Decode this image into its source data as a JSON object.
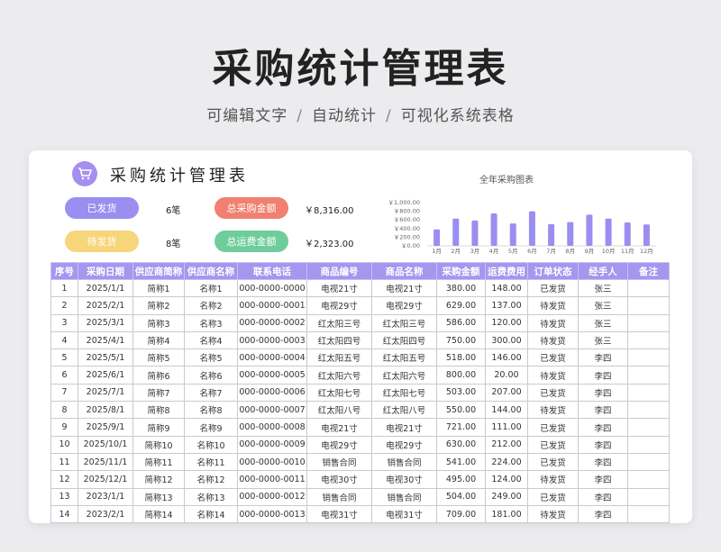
{
  "header": {
    "title": "采购统计管理表",
    "subtitle_parts": [
      "可编辑文字",
      "自动统计",
      "可视化系统表格"
    ],
    "separator": "/"
  },
  "card": {
    "title": "采购统计管理表",
    "logo_icon": "shopping-cart-icon",
    "stats": {
      "shipped_label": "已发货",
      "shipped_count": "6笔",
      "pending_label": "待发货",
      "pending_count": "8笔",
      "total_amount_label": "总采购金额",
      "total_amount": "￥8,316.00",
      "total_freight_label": "总运费金额",
      "total_freight": "￥2,323.00"
    },
    "colors": {
      "shipped": "#9a8ef0",
      "pending": "#f7d57a",
      "amount": "#f08070",
      "freight": "#6fcd9c",
      "table_header": "#a596ee",
      "bar": "#9a8ef0"
    }
  },
  "chart_data": {
    "type": "bar",
    "title": "全年采购图表",
    "categories": [
      "1月",
      "2月",
      "3月",
      "4月",
      "5月",
      "6月",
      "7月",
      "8月",
      "9月",
      "10月",
      "11月",
      "12月"
    ],
    "values": [
      380,
      629,
      586,
      750,
      518,
      800,
      503,
      550,
      721,
      630,
      541,
      495
    ],
    "ylim": [
      0,
      1000
    ],
    "yticks": [
      "￥1,000.00",
      "￥800.00",
      "￥600.00",
      "￥400.00",
      "￥200.00",
      "￥0.00"
    ],
    "ytick_values": [
      1000,
      800,
      600,
      400,
      200,
      0
    ],
    "grid": false,
    "legend": "none"
  },
  "table": {
    "columns": [
      "序号",
      "采购日期",
      "供应商简称",
      "供应商名称",
      "联系电话",
      "商品编号",
      "商品名称",
      "采购金额",
      "运费费用",
      "订单状态",
      "经手人",
      "备注"
    ],
    "rows": [
      [
        "1",
        "2025/1/1",
        "简称1",
        "名称1",
        "000-0000-0000",
        "电视21寸",
        "电视21寸",
        "380.00",
        "148.00",
        "已发货",
        "张三",
        ""
      ],
      [
        "2",
        "2025/2/1",
        "简称2",
        "名称2",
        "000-0000-0001",
        "电视29寸",
        "电视29寸",
        "629.00",
        "137.00",
        "待发货",
        "张三",
        ""
      ],
      [
        "3",
        "2025/3/1",
        "简称3",
        "名称3",
        "000-0000-0002",
        "红太阳三号",
        "红太阳三号",
        "586.00",
        "120.00",
        "待发货",
        "张三",
        ""
      ],
      [
        "4",
        "2025/4/1",
        "简称4",
        "名称4",
        "000-0000-0003",
        "红太阳四号",
        "红太阳四号",
        "750.00",
        "300.00",
        "待发货",
        "张三",
        ""
      ],
      [
        "5",
        "2025/5/1",
        "简称5",
        "名称5",
        "000-0000-0004",
        "红太阳五号",
        "红太阳五号",
        "518.00",
        "146.00",
        "已发货",
        "李四",
        ""
      ],
      [
        "6",
        "2025/6/1",
        "简称6",
        "名称6",
        "000-0000-0005",
        "红太阳六号",
        "红太阳六号",
        "800.00",
        "20.00",
        "待发货",
        "李四",
        ""
      ],
      [
        "7",
        "2025/7/1",
        "简称7",
        "名称7",
        "000-0000-0006",
        "红太阳七号",
        "红太阳七号",
        "503.00",
        "207.00",
        "已发货",
        "李四",
        ""
      ],
      [
        "8",
        "2025/8/1",
        "简称8",
        "名称8",
        "000-0000-0007",
        "红太阳八号",
        "红太阳八号",
        "550.00",
        "144.00",
        "待发货",
        "李四",
        ""
      ],
      [
        "9",
        "2025/9/1",
        "简称9",
        "名称9",
        "000-0000-0008",
        "电视21寸",
        "电视21寸",
        "721.00",
        "111.00",
        "已发货",
        "李四",
        ""
      ],
      [
        "10",
        "2025/10/1",
        "简称10",
        "名称10",
        "000-0000-0009",
        "电视29寸",
        "电视29寸",
        "630.00",
        "212.00",
        "已发货",
        "李四",
        ""
      ],
      [
        "11",
        "2025/11/1",
        "简称11",
        "名称11",
        "000-0000-0010",
        "销售合同",
        "销售合同",
        "541.00",
        "224.00",
        "已发货",
        "李四",
        ""
      ],
      [
        "12",
        "2025/12/1",
        "简称12",
        "名称12",
        "000-0000-0011",
        "电视30寸",
        "电视30寸",
        "495.00",
        "124.00",
        "待发货",
        "李四",
        ""
      ],
      [
        "13",
        "2023/1/1",
        "简称13",
        "名称13",
        "000-0000-0012",
        "销售合同",
        "销售合同",
        "504.00",
        "249.00",
        "已发货",
        "李四",
        ""
      ],
      [
        "14",
        "2023/2/1",
        "简称14",
        "名称14",
        "000-0000-0013",
        "电视31寸",
        "电视31寸",
        "709.00",
        "181.00",
        "待发货",
        "李四",
        ""
      ]
    ]
  }
}
